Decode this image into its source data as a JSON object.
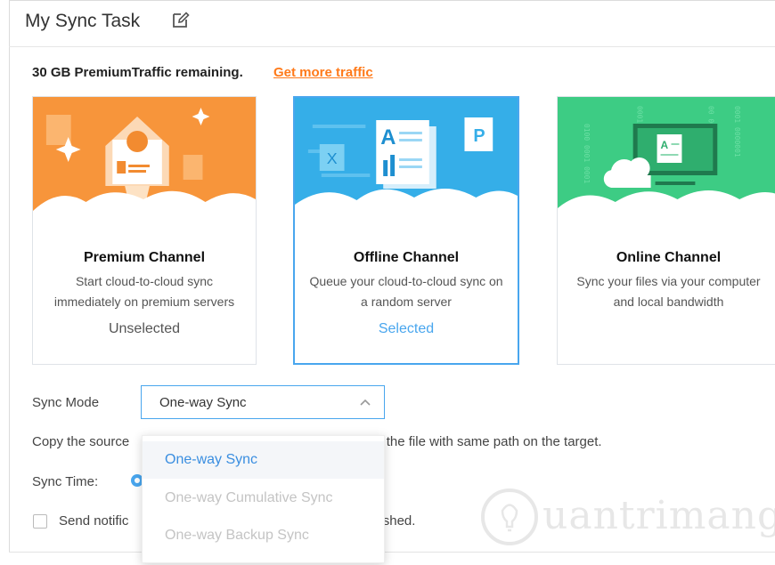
{
  "header": {
    "title": "My Sync Task",
    "edit_icon": "edit-icon"
  },
  "traffic": {
    "remaining": "30 GB PremiumTraffic remaining.",
    "link": "Get more traffic",
    "link_color": "#ff7a1a"
  },
  "channels": [
    {
      "name": "Premium Channel",
      "desc1": "Start cloud-to-cloud sync",
      "desc2": "immediately on premium servers",
      "status": "Unselected",
      "color": "#f7953b"
    },
    {
      "name": "Offline Channel",
      "desc1": "Queue your cloud-to-cloud sync on",
      "desc2": "a random server",
      "status": "Selected",
      "color": "#35aee8"
    },
    {
      "name": "Online Channel",
      "desc1": "Sync your files via your computer",
      "desc2": "and local bandwidth",
      "status": "",
      "color": "#3dcc84"
    }
  ],
  "sync_mode": {
    "label": "Sync Mode",
    "value": "One-way Sync"
  },
  "description": {
    "before": "Copy the source",
    "after": "o the file with same path on the target."
  },
  "sync_time": {
    "label": "Sync Time:"
  },
  "notify": {
    "before": "Send notific",
    "after": "ished."
  },
  "dropdown": {
    "options": [
      {
        "label": "One-way Sync",
        "state": "active"
      },
      {
        "label": "One-way Cumulative Sync",
        "state": "disabled"
      },
      {
        "label": "One-way Backup Sync",
        "state": "disabled"
      }
    ]
  },
  "watermark": {
    "text": "uantrimang",
    "logo_icon": "lightbulb-icon"
  },
  "colors": {
    "accent": "#49a6ee"
  }
}
